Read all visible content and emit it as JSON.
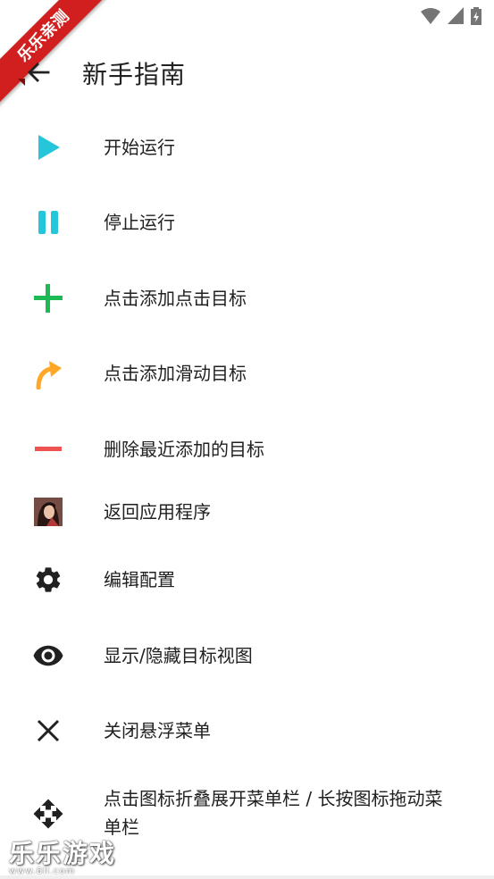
{
  "status_bar": {
    "ribbon_text": "乐乐亲测",
    "icons": [
      "wifi-icon",
      "signal-icon",
      "battery-icon"
    ]
  },
  "app_bar": {
    "title": "新手指南",
    "back_icon": "arrow-back-icon"
  },
  "menu": {
    "items": [
      {
        "label": "开始运行",
        "icon": "play-icon",
        "color": "#26c6da"
      },
      {
        "label": "停止运行",
        "icon": "pause-icon",
        "color": "#26c6da"
      },
      {
        "label": "点击添加点击目标",
        "icon": "plus-icon",
        "color": "#1db954"
      },
      {
        "label": "点击添加滑动目标",
        "icon": "curved-arrow-icon",
        "color": "#ffa726"
      },
      {
        "label": "删除最近添加的目标",
        "icon": "minus-icon",
        "color": "#ef5350"
      },
      {
        "label": "返回应用程序",
        "icon": "app-avatar-icon"
      },
      {
        "label": "编辑配置",
        "icon": "gear-icon",
        "color": "#212121"
      },
      {
        "label": "显示/隐藏目标视图",
        "icon": "eye-icon",
        "color": "#212121"
      },
      {
        "label": "关闭悬浮菜单",
        "icon": "close-icon",
        "color": "#212121"
      },
      {
        "label": "点击图标折叠展开菜单栏 / 长按图标拖动菜",
        "label_line2": "单栏",
        "icon": "move-icon",
        "color": "#212121"
      }
    ]
  },
  "watermark": {
    "title": "乐乐游戏",
    "url": "www.6ll.com"
  }
}
